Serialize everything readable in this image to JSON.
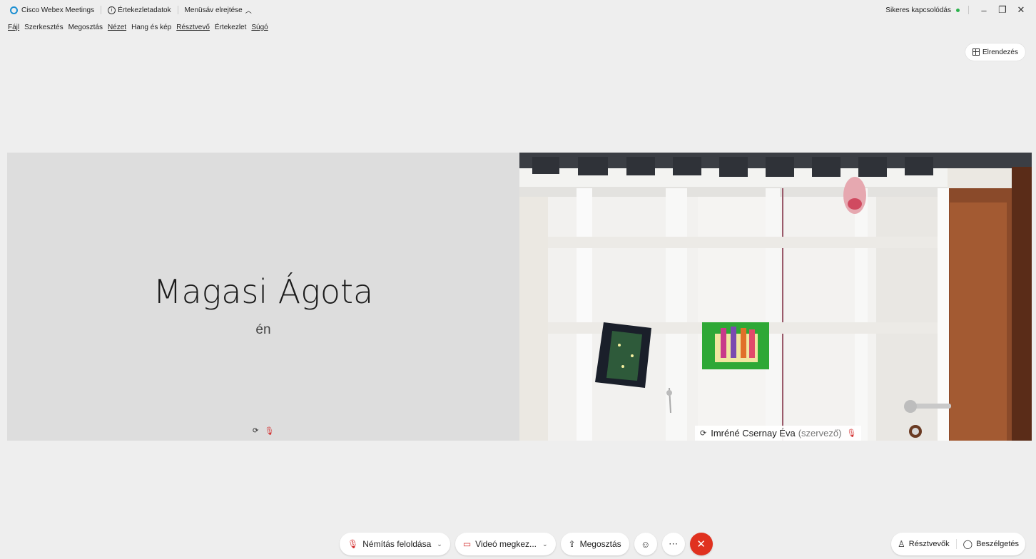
{
  "titlebar": {
    "app_name": "Cisco Webex Meetings",
    "meeting_info": "Értekezletadatok",
    "hide_menu": "Menüsáv elrejtése",
    "connection_status": "Sikeres kapcsolódás",
    "status_color": "#2bb24c"
  },
  "menu": {
    "file": "Fájl",
    "edit": "Szerkesztés",
    "share": "Megosztás",
    "view": "Nézet",
    "audio_video": "Hang és kép",
    "participant": "Résztvevő",
    "meeting": "Értekezlet",
    "help": "Súgó"
  },
  "layout_button": "Elrendezés",
  "self_tile": {
    "name": "Magasi Ágota",
    "subtitle": "én"
  },
  "remote_tile": {
    "name": "Imréné Csernay Éva",
    "role": "(szervező)"
  },
  "controls": {
    "unmute": "Némítás feloldása",
    "video": "Videó megkez...",
    "share": "Megosztás",
    "reactions_icon": "smiley-icon",
    "more_icon": "ellipsis-icon",
    "end_icon": "close-icon",
    "end_color": "#e0311f"
  },
  "side_controls": {
    "participants": "Résztvevők",
    "chat": "Beszélgetés"
  },
  "colors": {
    "background": "#eeeeee",
    "self_tile_bg": "#dddddd",
    "muted_mic": "#d32f2f",
    "logo": "#1b8fd2"
  }
}
